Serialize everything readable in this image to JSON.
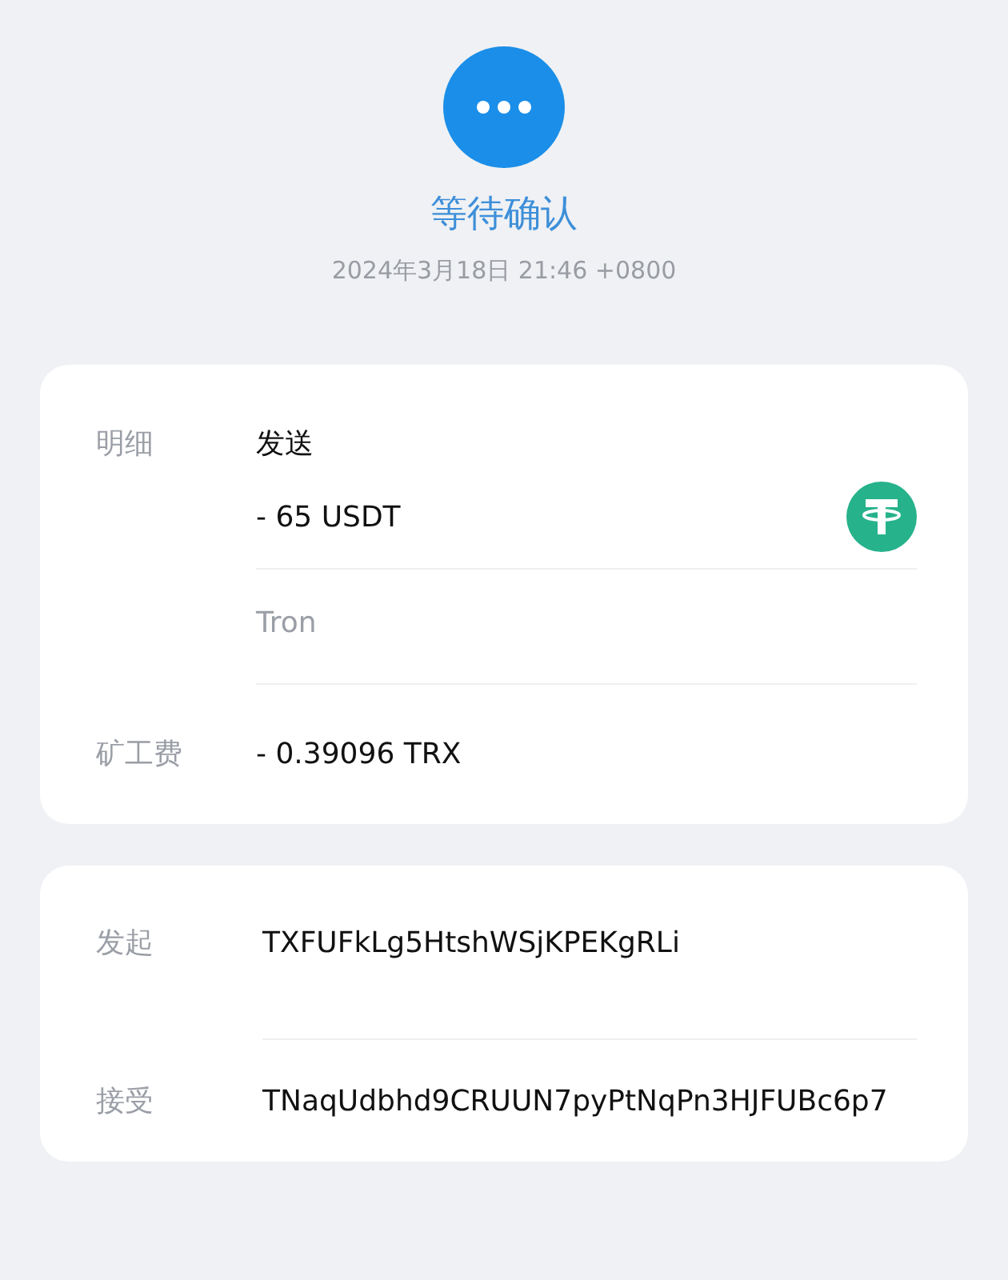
{
  "status": {
    "kind": "pending",
    "title": "等待确认",
    "time": "2024年3月18日 21:46 +0800"
  },
  "details": {
    "label": "明细",
    "type": "发送",
    "amount": "- 65 USDT",
    "network": "Tron"
  },
  "fee": {
    "label": "矿工费",
    "value": "- 0.39096 TRX"
  },
  "addresses": [
    {
      "label": "发起",
      "value": "TXFUFkLg5HtshWSjKPEKgRLi"
    },
    {
      "label": "接受",
      "value": "TNaqUdbhd9CRUUN7pyPtNqPn3HJFUBc6p7"
    }
  ]
}
